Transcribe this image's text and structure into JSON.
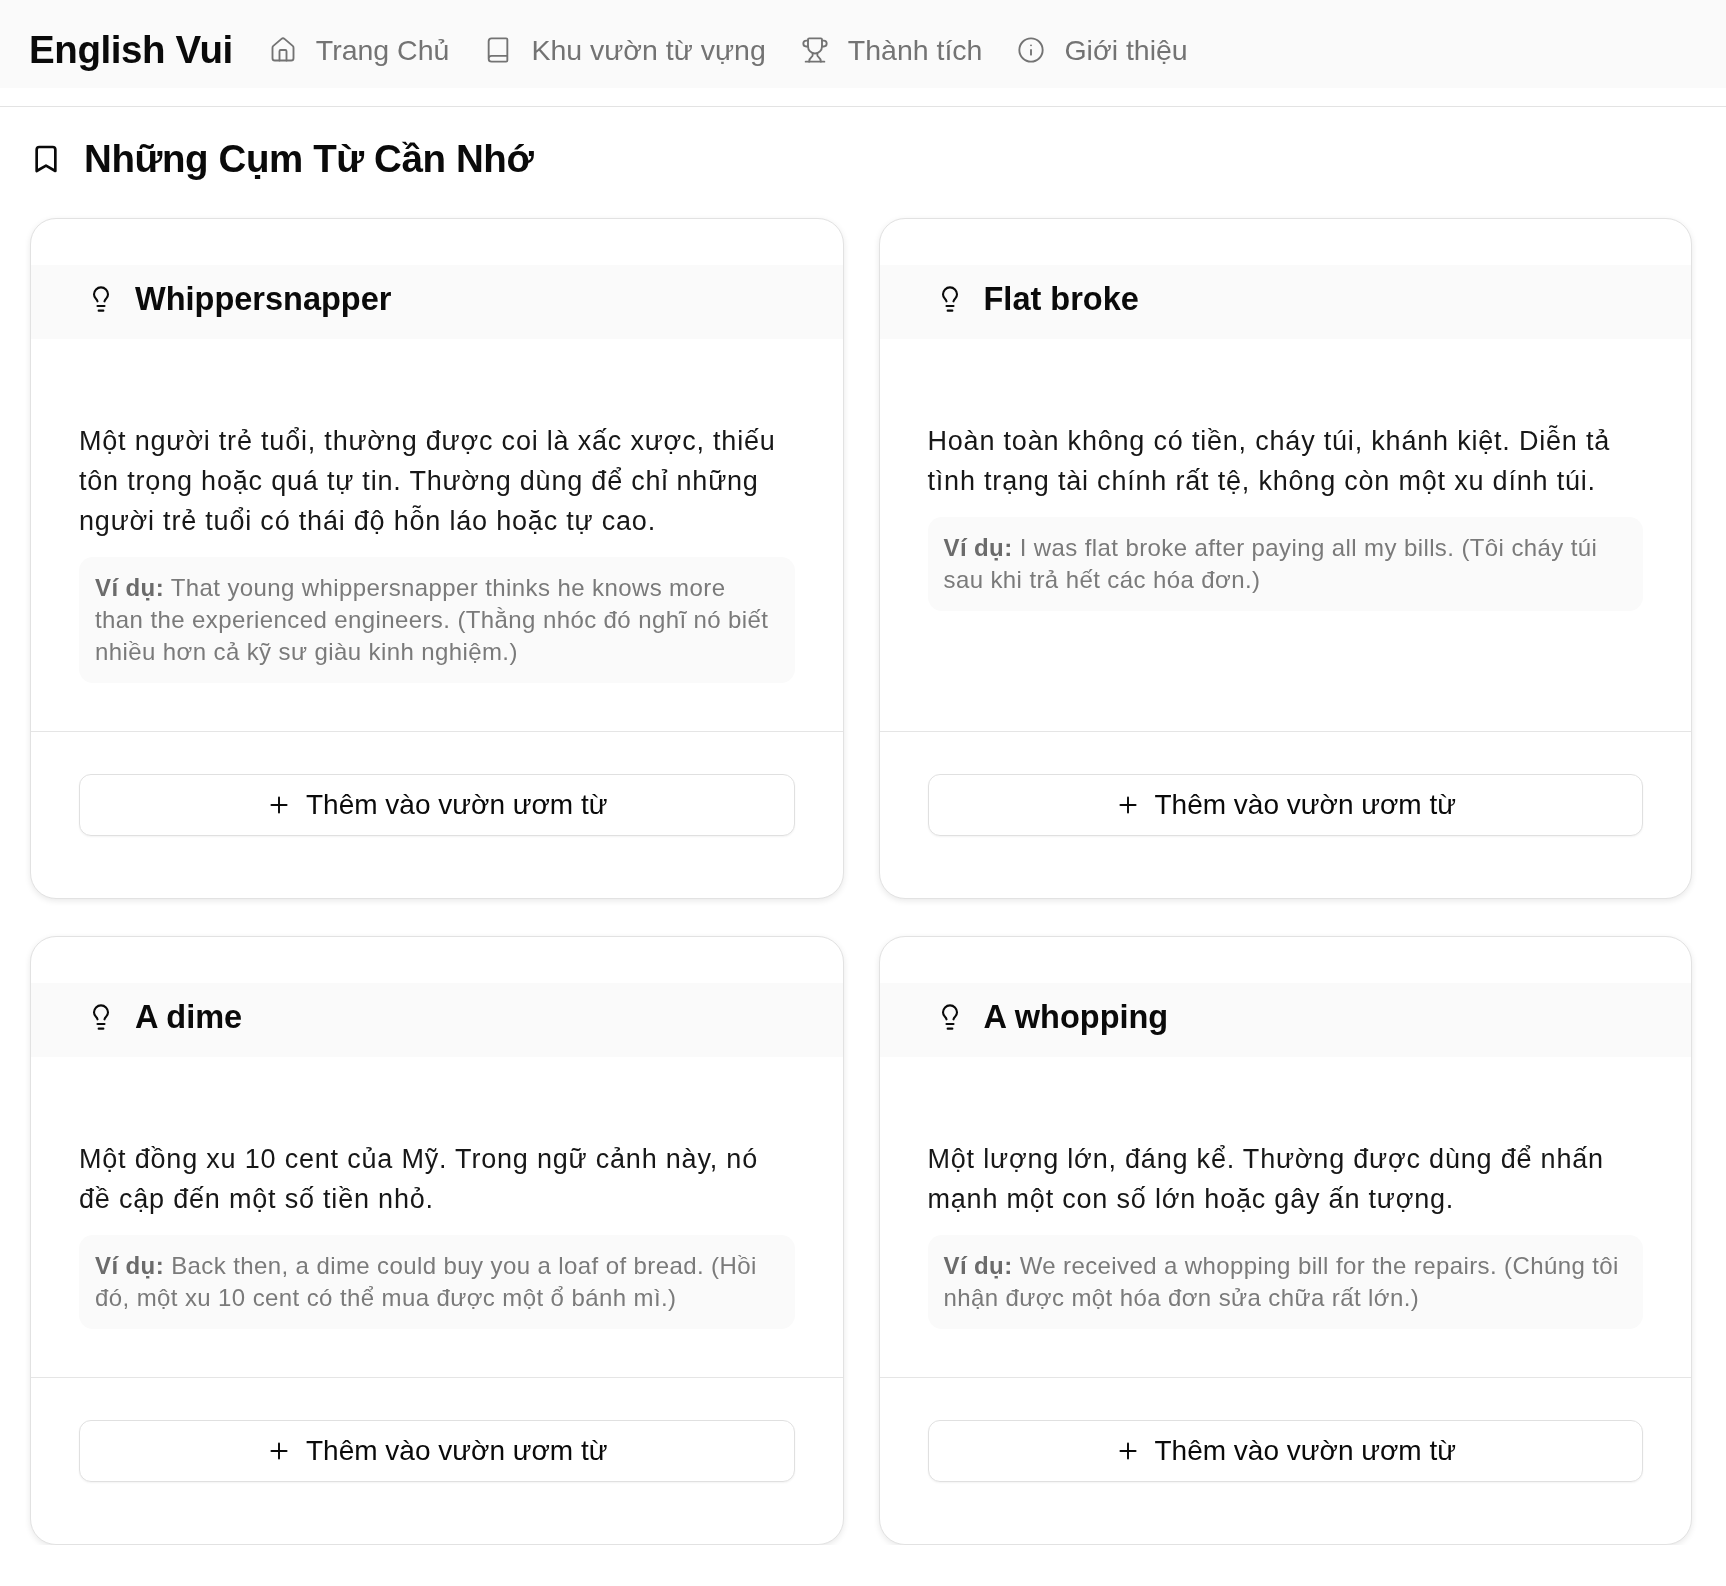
{
  "header": {
    "brand": "English Vui",
    "nav": [
      {
        "label": "Trang Chủ",
        "selected": false
      },
      {
        "label": "Khu vườn từ vựng",
        "selected": false
      },
      {
        "label": "Thành tích",
        "selected": false
      },
      {
        "label": "Giới thiệu",
        "selected": false
      }
    ]
  },
  "page_title": "Những Cụm Từ Cần Nhớ",
  "phrases": [
    {
      "phrase": "Whippersnapper",
      "meaning": "Một người trẻ tuổi, thường được coi là xấc xược, thiếu tôn trọng hoặc quá tự tin. Thường dùng để chỉ những người trẻ tuổi có thái độ hỗn láo hoặc tự cao.",
      "example": "**Ví dụ:** That young whippersnapper thinks he knows more than the experienced engineers. (Thằng nhóc đó nghĩ nó biết nhiều hơn cả kỹ sư giàu kinh nghiệm.)",
      "button": "Thêm vào vườn ươm từ"
    },
    {
      "phrase": "Flat broke",
      "meaning": "Hoàn toàn không có tiền, cháy túi, khánh kiệt. Diễn tả tình trạng tài chính rất tệ, không còn một xu dính túi.",
      "example": "**Ví dụ:** I was flat broke after paying all my bills. (Tôi cháy túi sau khi trả hết các hóa đơn.)",
      "button": "Thêm vào vườn ươm từ"
    },
    {
      "phrase": "A dime",
      "meaning": "Một đồng xu 10 cent của Mỹ. Trong ngữ cảnh này, nó đề cập đến một số tiền nhỏ.",
      "example": "**Ví dụ:** Back then, a dime could buy you a loaf of bread. (Hồi đó, một xu 10 cent có thể mua được một ổ bánh mì.)",
      "button": "Thêm vào vườn ươm từ"
    },
    {
      "phrase": "A whopping",
      "meaning": "Một lượng lớn, đáng kể. Thường được dùng để nhấn mạnh một con số lớn hoặc gây ấn tượng.",
      "example": "**Ví dụ:** We received a whopping bill for the repairs. (Chúng tôi nhận được một hóa đơn sửa chữa rất lớn.)",
      "button": "Thêm vào vườn ươm từ"
    }
  ]
}
